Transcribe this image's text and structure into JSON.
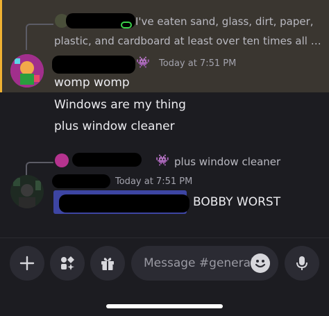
{
  "messages": [
    {
      "reply_preview": "I've eaten sand, glass, dirt, paper,",
      "reply_preview_line2": "plastic, and cardboard at least over ten times all …",
      "name_emoji": "👾",
      "timestamp": "Today at 7:51 PM",
      "lines": [
        "womp womp",
        "Windows are my thing",
        "plus window cleaner"
      ]
    },
    {
      "reply_preview": "plus window cleaner",
      "reply_emoji": "👾",
      "timestamp": "Today at 7:51 PM",
      "body": "BOBBY WORST"
    }
  ],
  "composer": {
    "placeholder": "Message #general"
  },
  "colors": {
    "highlight_bar": "#f0b232",
    "mention": "#3d45a3"
  }
}
